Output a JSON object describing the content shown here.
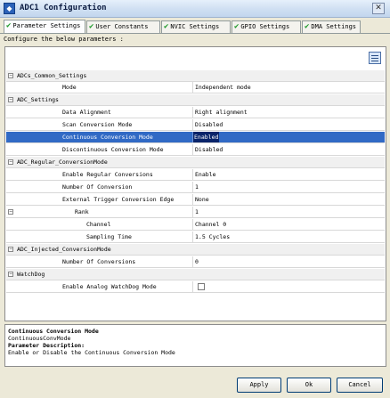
{
  "window": {
    "title": "ADC1 Configuration",
    "close_glyph": "✕"
  },
  "tabs": [
    {
      "label": "Parameter Settings",
      "icon": "check-icon",
      "active": true
    },
    {
      "label": "User Constants",
      "icon": "check-icon"
    },
    {
      "label": "NVIC Settings",
      "icon": "check-icon"
    },
    {
      "label": "GPIO Settings",
      "icon": "check-icon"
    },
    {
      "label": "DMA Settings",
      "icon": "check-icon"
    }
  ],
  "subtitle": "Configure the below parameters :",
  "groups": {
    "common": "ADCs_Common_Settings",
    "adc": "ADC_Settings",
    "regular": "ADC_Regular_ConversionMode",
    "injected": "ADC_Injected_ConversionMode",
    "watchdog": "WatchDog"
  },
  "params": {
    "mode": {
      "name": "Mode",
      "value": "Independent mode"
    },
    "align": {
      "name": "Data Alignment",
      "value": "Right alignment"
    },
    "scan": {
      "name": "Scan Conversion Mode",
      "value": "Disabled"
    },
    "continuous": {
      "name": "Continuous Conversion Mode",
      "value": "Enabled"
    },
    "discontinuous": {
      "name": "Discontinuous Conversion Mode",
      "value": "Disabled"
    },
    "enable_regular": {
      "name": "Enable Regular Conversions",
      "value": "Enable"
    },
    "num_conv": {
      "name": "Number Of Conversion",
      "value": "1"
    },
    "ext_trigger": {
      "name": "External Trigger Conversion Edge",
      "value": "None"
    },
    "rank": {
      "name": "Rank",
      "value": "1"
    },
    "channel": {
      "name": "Channel",
      "value": "Channel 0"
    },
    "sampling": {
      "name": "Sampling Time",
      "value": "1.5 Cycles"
    },
    "inj_num": {
      "name": "Number Of Conversions",
      "value": "0"
    },
    "analog_wd": {
      "name": "Enable Analog WatchDog Mode",
      "checked": false
    }
  },
  "description": {
    "title": "Continuous Conversion Mode",
    "identifier": "ContinuousConvMode",
    "param_heading": "Parameter Description:",
    "text": "Enable or Disable the Continuous Conversion Mode"
  },
  "buttons": {
    "apply": "Apply",
    "ok": "Ok",
    "cancel": "Cancel"
  },
  "colors": {
    "selection": "#316ac5",
    "check": "#1e9a2a"
  }
}
